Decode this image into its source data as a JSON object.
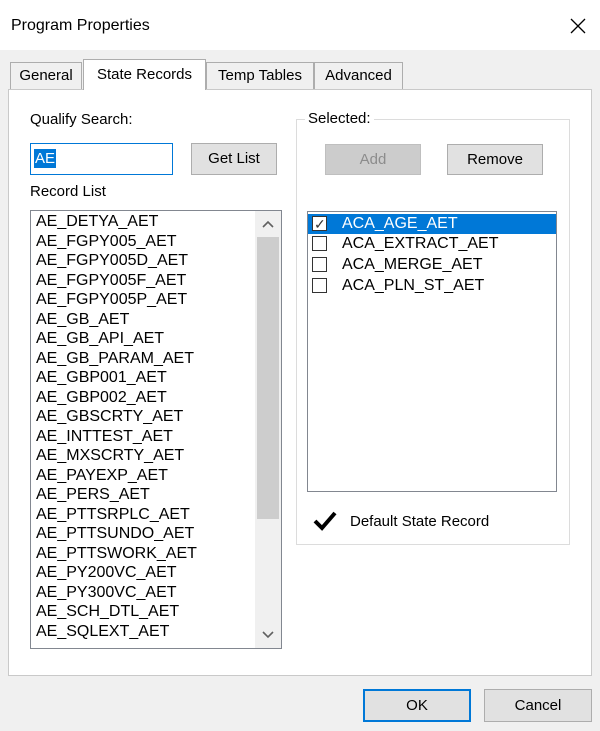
{
  "window": {
    "title": "Program Properties"
  },
  "tabs": [
    {
      "label": "General"
    },
    {
      "label": "State Records"
    },
    {
      "label": "Temp Tables"
    },
    {
      "label": "Advanced"
    }
  ],
  "left": {
    "qualify_label": "Qualify Search:",
    "search_value": "AE",
    "get_list_label": "Get List",
    "record_list_label": "Record List",
    "records": [
      "AE_DETYA_AET",
      "AE_FGPY005_AET",
      "AE_FGPY005D_AET",
      "AE_FGPY005F_AET",
      "AE_FGPY005P_AET",
      "AE_GB_AET",
      "AE_GB_API_AET",
      "AE_GB_PARAM_AET",
      "AE_GBP001_AET",
      "AE_GBP002_AET",
      "AE_GBSCRTY_AET",
      "AE_INTTEST_AET",
      "AE_MXSCRTY_AET",
      "AE_PAYEXP_AET",
      "AE_PERS_AET",
      "AE_PTTSRPLC_AET",
      "AE_PTTSUNDO_AET",
      "AE_PTTSWORK_AET",
      "AE_PY200VC_AET",
      "AE_PY300VC_AET",
      "AE_SCH_DTL_AET",
      "AE_SQLEXT_AET"
    ]
  },
  "selected": {
    "group_label": "Selected:",
    "add_label": "Add",
    "remove_label": "Remove",
    "items": [
      {
        "label": "ACA_AGE_AET",
        "checked": true
      },
      {
        "label": "ACA_EXTRACT_AET",
        "checked": false
      },
      {
        "label": "ACA_MERGE_AET",
        "checked": false
      },
      {
        "label": "ACA_PLN_ST_AET",
        "checked": false
      }
    ],
    "default_state_label": "Default State Record"
  },
  "footer": {
    "ok_label": "OK",
    "cancel_label": "Cancel"
  },
  "colors": {
    "accent": "#0078d7",
    "dialog_bg": "#f0f0f0"
  }
}
